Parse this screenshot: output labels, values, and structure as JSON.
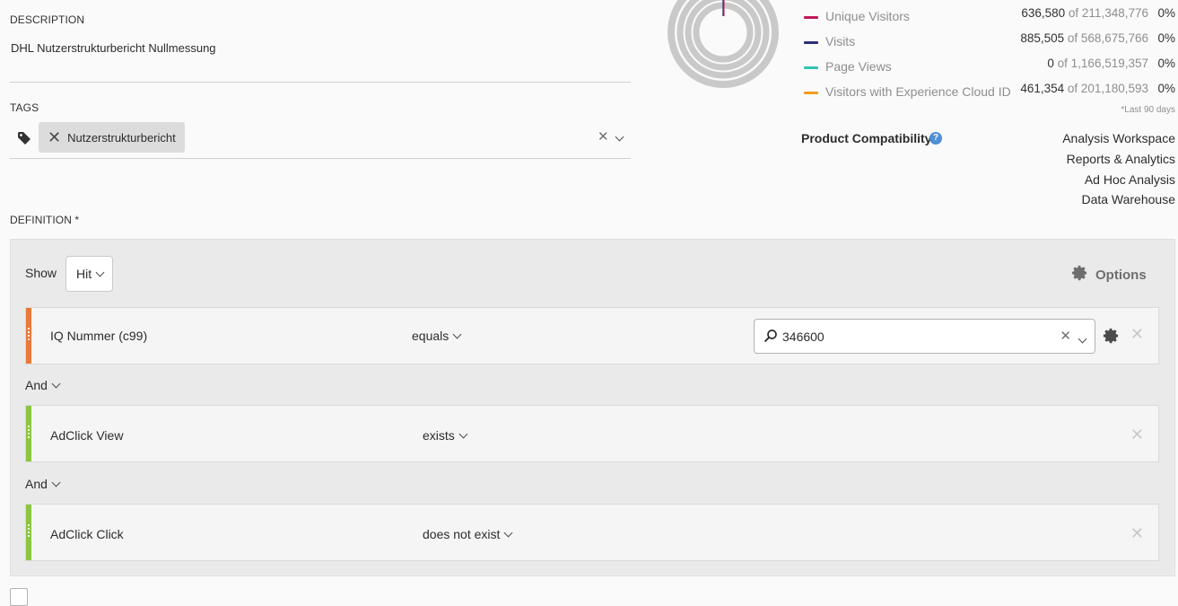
{
  "description": {
    "label": "DESCRIPTION",
    "value": "DHL Nutzerstrukturbericht Nullmessung"
  },
  "tags": {
    "label": "TAGS",
    "chip": "Nutzerstrukturbericht",
    "tag_icon": "tag-icon",
    "clear_icon": "close-icon",
    "dropdown_icon": "chevron-down-icon"
  },
  "stats": {
    "rows": [
      {
        "name": "Unique Visitors",
        "value": "636,580",
        "of": "of 211,348,776",
        "pct": "0%",
        "color": "#c2185b"
      },
      {
        "name": "Visits",
        "value": "885,505",
        "of": "of 568,675,766",
        "pct": "0%",
        "color": "#2c2f7a"
      },
      {
        "name": "Page Views",
        "value": "0",
        "of": "of 1,166,519,357",
        "pct": "0%",
        "color": "#2fc4b2"
      },
      {
        "name": "Visitors with Experience Cloud ID",
        "value": "461,354",
        "of": "of 201,180,593",
        "pct": "0%",
        "color": "#f29d1f"
      }
    ],
    "footnote": "*Last 90 days"
  },
  "compatibility": {
    "label": "Product Compatibility",
    "help_icon": "help-icon",
    "items": [
      "Analysis Workspace",
      "Reports & Analytics",
      "Ad Hoc Analysis",
      "Data Warehouse"
    ]
  },
  "definition": {
    "label": "DEFINITION *",
    "show_label": "Show",
    "show_value": "Hit",
    "options_label": "Options",
    "options_icon": "gear-icon",
    "rules": [
      {
        "dimension": "IQ Nummer (c99)",
        "operator": "equals",
        "value": "346600",
        "bar_color": "#e8793a"
      },
      {
        "dimension": "AdClick View",
        "operator": "exists",
        "bar_color": "#8cc540"
      },
      {
        "dimension": "AdClick Click",
        "operator": "does not exist",
        "bar_color": "#8cc540"
      }
    ],
    "connectors": [
      "And",
      "And"
    ]
  }
}
